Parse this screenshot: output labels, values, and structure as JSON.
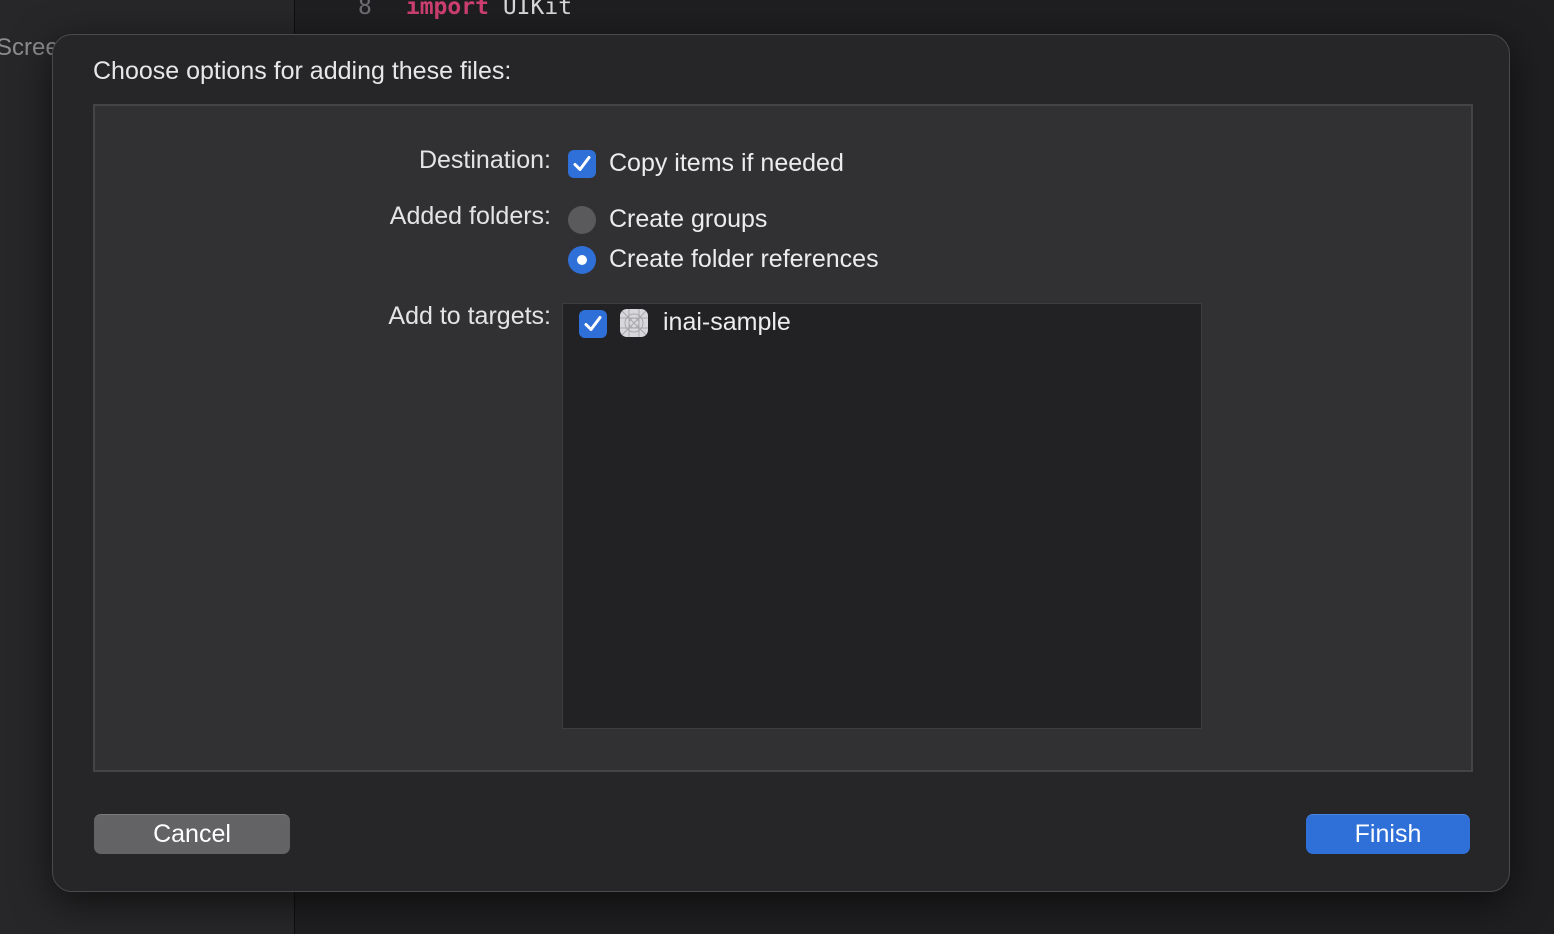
{
  "background": {
    "sidebar_text": "Scree",
    "code": {
      "line_number": "8",
      "keyword": "import",
      "identifier": "UIKit"
    }
  },
  "dialog": {
    "title": "Choose options for adding these files:",
    "destination": {
      "label": "Destination:",
      "option_label": "Copy items if needed",
      "checked": true
    },
    "added_folders": {
      "label": "Added folders:",
      "options": [
        {
          "label": "Create groups",
          "selected": false
        },
        {
          "label": "Create folder references",
          "selected": true
        }
      ]
    },
    "add_to_targets": {
      "label": "Add to targets:",
      "targets": [
        {
          "name": "inai-sample",
          "checked": true,
          "icon": "app-target-icon"
        }
      ]
    },
    "buttons": {
      "cancel": "Cancel",
      "finish": "Finish"
    }
  },
  "colors": {
    "accent": "#2f6fd8",
    "sheet_background": "#262628",
    "panel_background": "#313133"
  }
}
